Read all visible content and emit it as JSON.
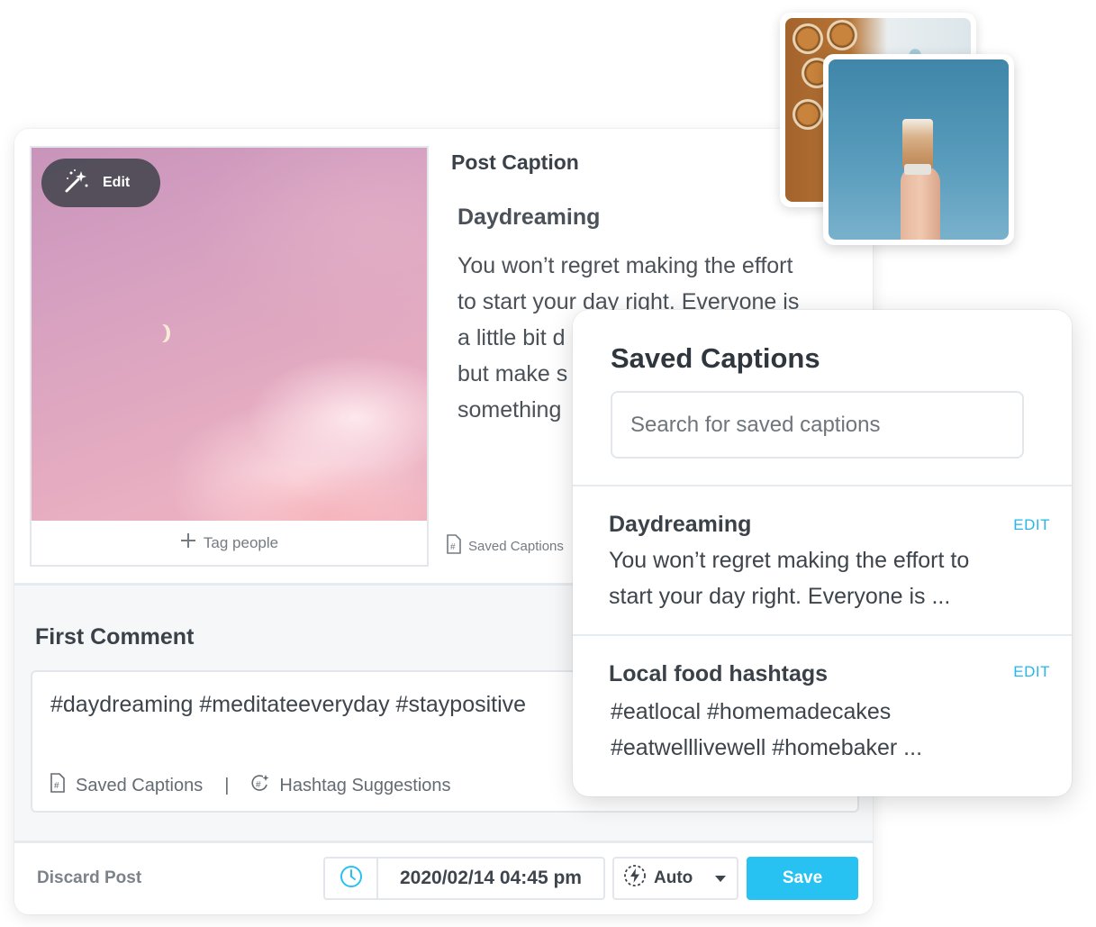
{
  "post": {
    "edit_label": "Edit",
    "tag_people_label": "Tag people",
    "caption_section_title": "Post Caption",
    "caption_heading": "Daydreaming",
    "caption_lines": [
      "You won’t regret making the effort",
      "to start your day right. Everyone is",
      "a little bit d",
      "but make s",
      "something"
    ],
    "caption_saved_label": "Saved Captions"
  },
  "first_comment": {
    "title": "First Comment",
    "text": "#daydreaming #meditateeveryday #staypositive",
    "saved_captions_label": "Saved Captions",
    "separator": "|",
    "hashtag_suggestions_label": "Hashtag Suggestions"
  },
  "footer": {
    "discard_label": "Discard Post",
    "schedule_datetime": "2020/02/14 04:45 pm",
    "auto_label": "Auto",
    "save_label": "Save"
  },
  "saved_captions": {
    "title": "Saved Captions",
    "search_placeholder": "Search for saved captions",
    "items": [
      {
        "title": "Daydreaming",
        "edit_label": "EDIT",
        "lines": [
          "You won’t regret making the effort to",
          "start your day right. Everyone is ..."
        ]
      },
      {
        "title": "Local food hashtags",
        "edit_label": "EDIT",
        "lines": [
          "#eatlocal #homemadecakes",
          "#eatwelllivewell #homebaker ..."
        ]
      }
    ]
  },
  "colors": {
    "accent": "#27c2f2",
    "edit_link": "#27b5ea",
    "text_dark": "#3a4148",
    "text_muted": "#747b82",
    "border": "#e3e7eb"
  },
  "icons": {
    "edit": "magic-wand-icon",
    "tag": "plus-icon",
    "saved_captions": "saved-captions-icon",
    "hashtag": "hashtag-suggestion-icon",
    "clock": "clock-icon",
    "auto": "auto-publish-icon",
    "dropdown": "chevron-down-icon"
  }
}
